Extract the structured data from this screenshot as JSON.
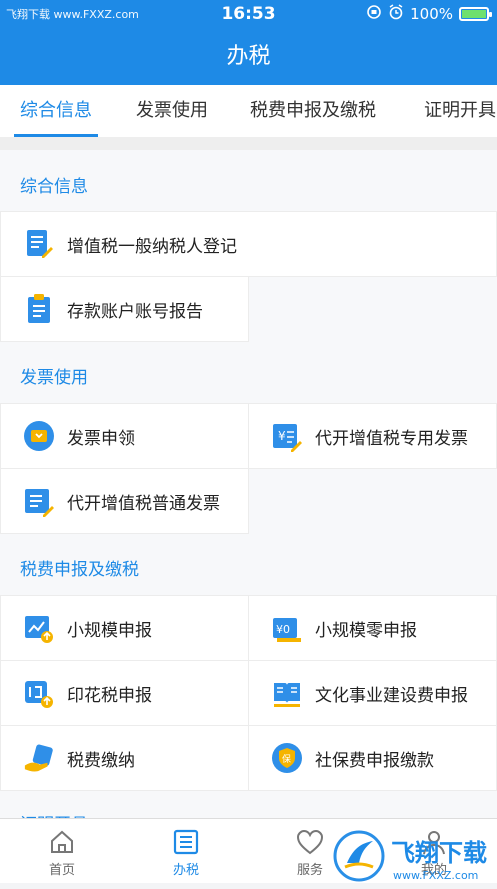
{
  "status": {
    "watermark": "飞翔下载 www.FXXZ.com",
    "time": "16:53",
    "battery": "100%"
  },
  "header": {
    "title": "办税"
  },
  "tabs": [
    {
      "label": "综合信息"
    },
    {
      "label": "发票使用"
    },
    {
      "label": "税费申报及缴税"
    },
    {
      "label": "证明开具"
    }
  ],
  "sections": {
    "general": {
      "title": "综合信息",
      "items": [
        {
          "label": "增值税一般纳税人登记"
        },
        {
          "label": "存款账户账号报告"
        }
      ]
    },
    "invoice": {
      "title": "发票使用",
      "items": [
        {
          "label": "发票申领"
        },
        {
          "label": "代开增值税专用发票"
        },
        {
          "label": "代开增值税普通发票"
        }
      ]
    },
    "declare": {
      "title": "税费申报及缴税",
      "items": [
        {
          "label": "小规模申报"
        },
        {
          "label": "小规模零申报"
        },
        {
          "label": "印花税申报"
        },
        {
          "label": "文化事业建设费申报"
        },
        {
          "label": "税费缴纳"
        },
        {
          "label": "社保费申报缴款"
        }
      ]
    },
    "proof": {
      "title": "证明开具"
    }
  },
  "tabbar": [
    {
      "label": "首页"
    },
    {
      "label": "办税"
    },
    {
      "label": "服务"
    },
    {
      "label": "我的"
    }
  ],
  "brand": {
    "name": "飞翔下载",
    "url": "www.FXXZ.com"
  },
  "colors": {
    "accent": "#1e8ae6",
    "icon_blue": "#2f8fe8",
    "icon_yellow": "#f5b400"
  }
}
